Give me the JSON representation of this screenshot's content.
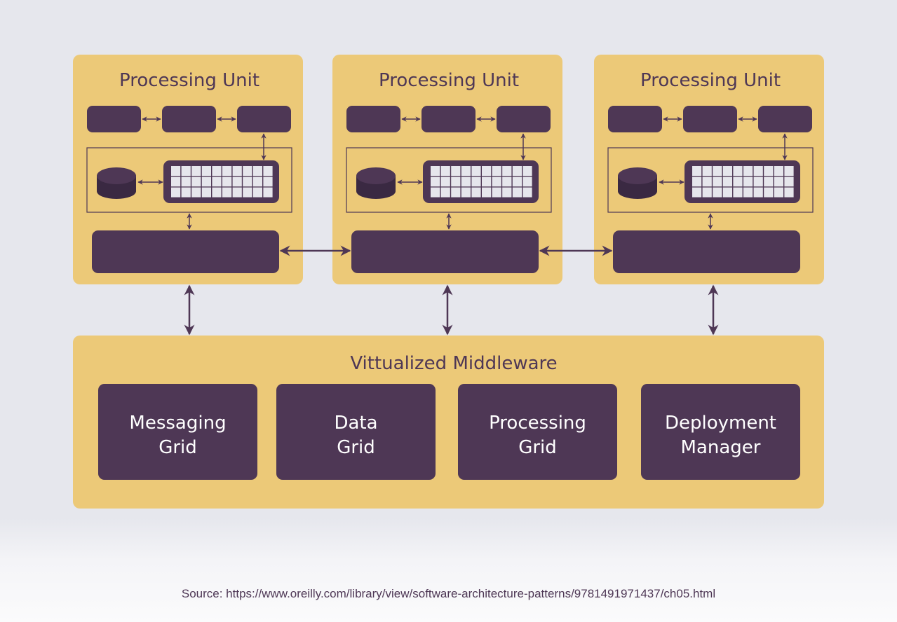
{
  "colors": {
    "background": "#e6e7ed",
    "container": "#ecc978",
    "block": "#4e3755",
    "grid_cell": "#e6e6ec"
  },
  "processing_units": [
    {
      "title": "Processing Unit"
    },
    {
      "title": "Processing Unit"
    },
    {
      "title": "Processing Unit"
    }
  ],
  "middleware": {
    "title": "Vittualized Middleware",
    "components": [
      {
        "line1": "Messaging",
        "line2": "Grid"
      },
      {
        "line1": "Data",
        "line2": "Grid"
      },
      {
        "line1": "Processing",
        "line2": "Grid"
      },
      {
        "line1": "Deployment",
        "line2": "Manager"
      }
    ]
  },
  "source": "Source: https://www.oreilly.com/library/view/software-architecture-patterns/9781491971437/ch05.html"
}
